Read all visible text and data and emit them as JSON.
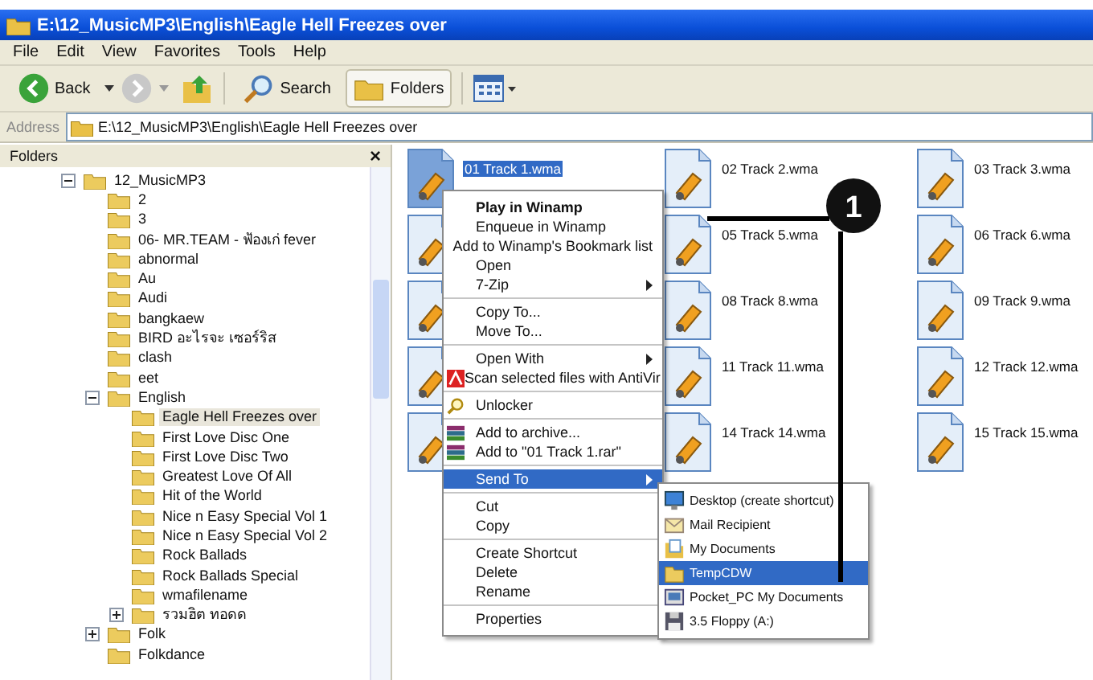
{
  "window": {
    "title": "E:\\12_MusicMP3\\English\\Eagle Hell Freezes over"
  },
  "menu_bar": [
    "File",
    "Edit",
    "View",
    "Favorites",
    "Tools",
    "Help"
  ],
  "toolbar": {
    "back": "Back",
    "search": "Search",
    "folders": {
      "label": "Folders",
      "selected": true
    }
  },
  "address": {
    "label": "Address",
    "value": "E:\\12_MusicMP3\\English\\Eagle Hell Freezes over"
  },
  "folders_pane": {
    "title": "Folders",
    "close": "×"
  },
  "tree": [
    {
      "label": "12_MusicMP3",
      "selected": false,
      "expanded": true,
      "children": [
        {
          "label": "2",
          "selected": false
        },
        {
          "label": "3",
          "selected": false
        },
        {
          "label": "06- MR.TEAM - ฟ้องเก่ fever",
          "selected": false
        },
        {
          "label": "abnormal",
          "selected": false
        },
        {
          "label": "Au",
          "selected": false
        },
        {
          "label": "Audi",
          "selected": false
        },
        {
          "label": "bangkaew",
          "selected": false
        },
        {
          "label": "BIRD อะไรจะ เซอร์ริส",
          "selected": false
        },
        {
          "label": "clash",
          "selected": false
        },
        {
          "label": "eet",
          "selected": false
        },
        {
          "label": "English",
          "selected": false,
          "expanded": true,
          "children": [
            {
              "label": "Eagle Hell Freezes over",
              "selected": true
            },
            {
              "label": "First Love Disc One",
              "selected": false
            },
            {
              "label": "First Love Disc Two",
              "selected": false
            },
            {
              "label": "Greatest Love Of All",
              "selected": false
            },
            {
              "label": "Hit of the World",
              "selected": false
            },
            {
              "label": "Nice n Easy Special Vol 1",
              "selected": false
            },
            {
              "label": "Nice n Easy Special Vol 2",
              "selected": false
            },
            {
              "label": "Rock Ballads",
              "selected": false
            },
            {
              "label": "Rock Ballads Special",
              "selected": false
            },
            {
              "label": "wmafilename",
              "selected": false
            },
            {
              "label": "รวมฮิต ทอดด",
              "selected": false,
              "expanded": false
            }
          ]
        },
        {
          "label": "Folk",
          "selected": false,
          "expanded": false
        },
        {
          "label": "Folkdance",
          "selected": false
        }
      ]
    }
  ],
  "files": [
    {
      "name": "01 Track 1.wma",
      "selected": true
    },
    {
      "name": "02 Track 2.wma",
      "selected": false
    },
    {
      "name": "03 Track 3.wma",
      "selected": false
    },
    {
      "selected": false
    },
    {
      "name": "05 Track 5.wma",
      "selected": false
    },
    {
      "name": "06 Track 6.wma",
      "selected": false
    },
    {
      "selected": false
    },
    {
      "name": "08 Track 8.wma",
      "selected": false
    },
    {
      "name": "09 Track 9.wma",
      "selected": false
    },
    {
      "selected": false
    },
    {
      "name": "11 Track 11.wma",
      "selected": false
    },
    {
      "name": "12 Track 12.wma",
      "selected": false
    },
    {
      "selected": false
    },
    {
      "name": "14 Track 14.wma",
      "selected": false
    },
    {
      "name": "15 Track 15.wma",
      "selected": false
    }
  ],
  "context_menu": {
    "groups": [
      [
        {
          "label": "Play in Winamp",
          "default": true,
          "selected": false
        },
        {
          "label": "Enqueue in Winamp",
          "selected": false
        },
        {
          "label": "Add to Winamp's Bookmark list",
          "selected": false
        },
        {
          "label": "Open",
          "selected": false
        },
        {
          "label": "7-Zip",
          "submenu": true,
          "selected": false
        }
      ],
      [
        {
          "label": "Copy To...",
          "selected": false
        },
        {
          "label": "Move To...",
          "selected": false
        }
      ],
      [
        {
          "label": "Open With",
          "submenu": true,
          "selected": false
        },
        {
          "label": "Scan selected files with AntiVir",
          "kind": "antivir",
          "selected": false
        }
      ],
      [
        {
          "label": "Unlocker",
          "kind": "unlocker",
          "selected": false
        }
      ],
      [
        {
          "label": "Add to archive...",
          "kind": "archive",
          "selected": false
        },
        {
          "label": "Add to \"01 Track 1.rar\"",
          "kind": "archive",
          "selected": false
        }
      ],
      [
        {
          "label": "Send To",
          "submenu": true,
          "selected": true
        }
      ],
      [
        {
          "label": "Cut",
          "selected": false
        },
        {
          "label": "Copy",
          "selected": false
        }
      ],
      [
        {
          "label": "Create Shortcut",
          "selected": false
        },
        {
          "label": "Delete",
          "selected": false
        },
        {
          "label": "Rename",
          "selected": false
        }
      ],
      [
        {
          "label": "Properties",
          "selected": false
        }
      ]
    ]
  },
  "send_to_menu": [
    {
      "label": "Desktop (create shortcut)",
      "kind": "desktop",
      "selected": false
    },
    {
      "label": "Mail Recipient",
      "kind": "mail",
      "selected": false
    },
    {
      "label": "My Documents",
      "kind": "documents",
      "selected": false
    },
    {
      "label": "TempCDW",
      "kind": "folder",
      "selected": true
    },
    {
      "label": "Pocket_PC My Documents",
      "kind": "pocketpc",
      "selected": false
    },
    {
      "label": "3.5 Floppy (A:)",
      "kind": "floppy",
      "selected": false
    }
  ],
  "callout": {
    "label": "1"
  }
}
